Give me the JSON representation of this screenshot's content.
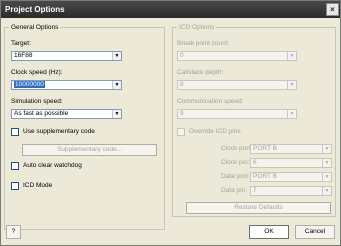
{
  "window": {
    "title": "Project Options",
    "close_glyph": "×"
  },
  "general": {
    "legend": "General Options",
    "target_label": "Target:",
    "target_value": "16F88",
    "clock_label": "Clock speed (Hz):",
    "clock_value": "10000000",
    "sim_label": "Simulation speed:",
    "sim_value": "As fast as possible",
    "use_supp_label": "Use supplementary code",
    "supp_button": "Supplementary code...",
    "watchdog_label": "Auto clear watchdog",
    "icd_mode_label": "ICD Mode"
  },
  "icd": {
    "legend": "ICD Options",
    "breakpoint_label": "Break point count:",
    "breakpoint_value": "0",
    "callstack_label": "Callstack depth:",
    "callstack_value": "8",
    "comm_label": "Communication speed:",
    "comm_value": "9",
    "override_label": "Override ICD pins",
    "clock_port_label": "Clock port:",
    "clock_port_value": "PORT B",
    "clock_pin_label": "Clock pin:",
    "clock_pin_value": "6",
    "data_port_label": "Data port:",
    "data_port_value": "PORT B",
    "data_pin_label": "Data pin:",
    "data_pin_value": "7",
    "restore_button": "Restore Defaults"
  },
  "footer": {
    "help": "?",
    "ok": "OK",
    "cancel": "Cancel"
  },
  "icons": {
    "dropdown": "▼",
    "close": "close-icon"
  }
}
